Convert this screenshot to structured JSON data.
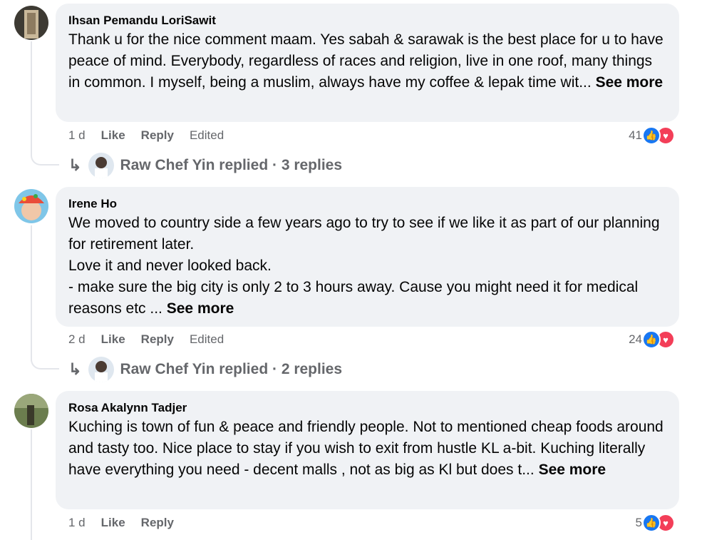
{
  "comments": [
    {
      "author": "Ihsan Pemandu LoriSawit",
      "text": "Thank u for the nice comment maam. Yes sabah & sarawak is the best place for u to have peace of mind. Everybody, regardless of races and religion, live in one roof, many things in common. I myself, being a muslim, always have my coffee & lepak time wit...",
      "see_more": "See more",
      "time": "1 d",
      "like": "Like",
      "reply": "Reply",
      "edited": "Edited",
      "reactions": "41",
      "replies_text": "Raw Chef Yin replied · 3 replies"
    },
    {
      "author": "Irene Ho",
      "text": "We moved to country side a few years ago to try to see if we like it as part of our planning for retirement later.\nLove it and never looked back.\n- make sure the big city is only 2 to 3 hours away. Cause you might need it for medical reasons etc ...",
      "see_more": "See more",
      "time": "2 d",
      "like": "Like",
      "reply": "Reply",
      "edited": "Edited",
      "reactions": "24",
      "replies_text": "Raw Chef Yin replied · 2 replies"
    },
    {
      "author": "Rosa Akalynn Tadjer",
      "text": "Kuching is town of fun & peace and friendly people. Not to mentioned cheap foods around and tasty too. Nice place to stay if you wish to exit from hustle KL a-bit. Kuching literally have everything you need - decent malls , not as big as Kl but does t...",
      "see_more": "See more",
      "time": "1 d",
      "like": "Like",
      "reply": "Reply",
      "reactions": "5"
    }
  ],
  "colors": {
    "bubble": "#f0f2f5",
    "like": "#1877f2",
    "love": "#f33e58",
    "meta": "#65676b"
  },
  "icons": [
    "reply-arrow-icon",
    "like-reaction-icon",
    "love-reaction-icon"
  ]
}
